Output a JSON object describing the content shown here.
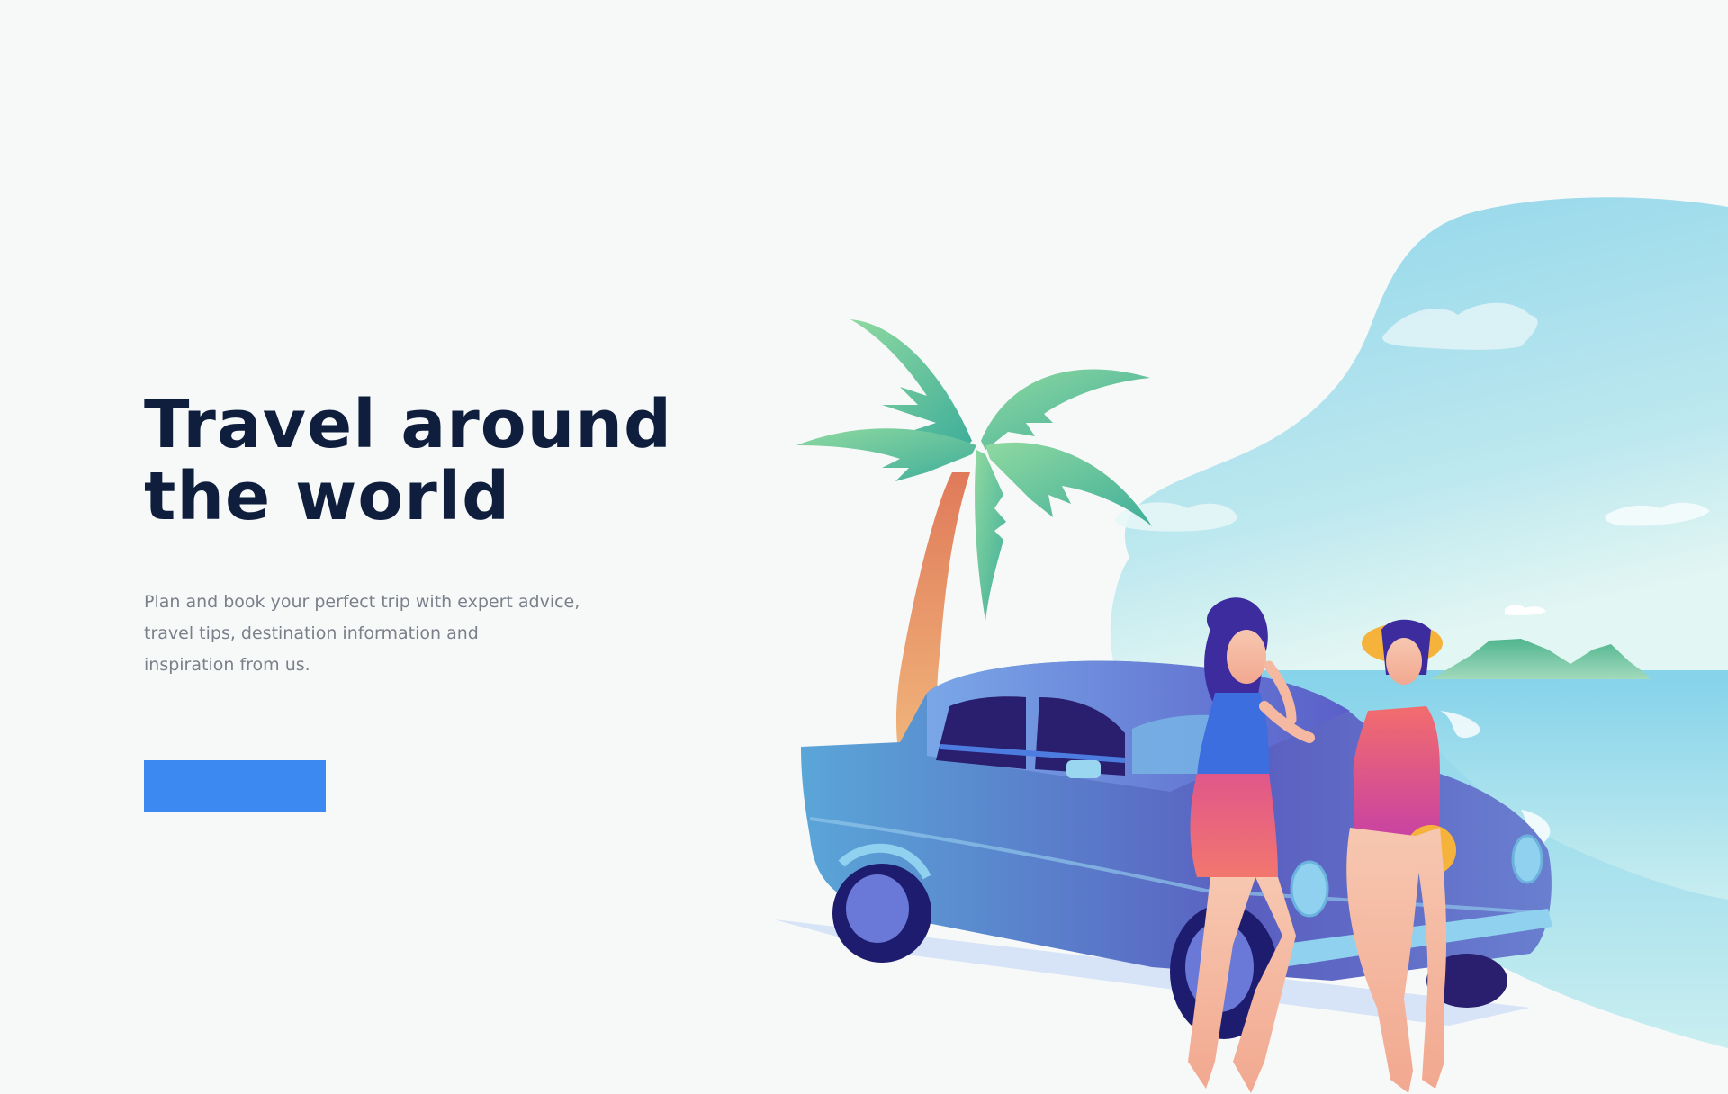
{
  "hero": {
    "title_line1": "Travel around",
    "title_line2": "the world",
    "description_line1": "Plan and book your perfect trip with expert advice,",
    "description_line2": "travel tips, destination information and",
    "description_line3": "inspiration from us.",
    "cta_label": ""
  },
  "colors": {
    "background": "#f7f9f9",
    "title": "#0f1e3d",
    "description": "#7b7f8a",
    "cta": "#3b89f1"
  },
  "illustration": {
    "icons": [
      "sky-blob",
      "cloud",
      "mountains",
      "sea",
      "palm-tree",
      "car",
      "woman-left",
      "woman-right"
    ]
  }
}
